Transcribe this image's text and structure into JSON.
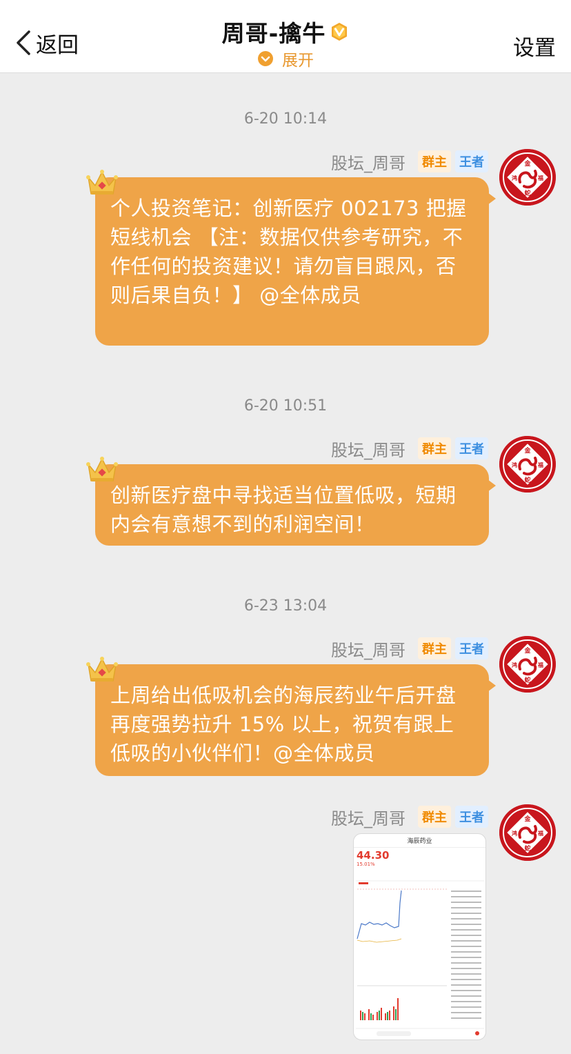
{
  "header": {
    "back_label": "返回",
    "title": "周哥-擒牛",
    "expand_label": "展开",
    "settings_label": "设置"
  },
  "messages": [
    {
      "time": "6-20 10:14",
      "sender": "股坛_周哥",
      "role_tag": "群主",
      "level_tag": "王者",
      "text": "个人投资笔记：创新医疗 002173 把握短线机会 【注：数据仅供参考研究，不作任何的投资建议！请勿盲目跟风，否则后果自负！】 @全体成员"
    },
    {
      "time": "6-20 10:51",
      "sender": "股坛_周哥",
      "role_tag": "群主",
      "level_tag": "王者",
      "text": "创新医疗盘中寻找适当位置低吸，短期内会有意想不到的利润空间！"
    },
    {
      "time": "6-23 13:04",
      "sender": "股坛_周哥",
      "role_tag": "群主",
      "level_tag": "王者",
      "text": "上周给出低吸机会的海辰药业午后开盘再度强势拉升 15% 以上，祝贺有跟上低吸的小伙伴们！@全体成员"
    },
    {
      "sender": "股坛_周哥",
      "role_tag": "群主",
      "level_tag": "王者",
      "image": {
        "title": "海辰药业",
        "price": "44.30",
        "change": "15.01%"
      }
    }
  ],
  "avatar_text": [
    "金",
    "鸿",
    "福",
    "蛇"
  ],
  "colors": {
    "bubble": "#efa448",
    "accent": "#e8982f",
    "avatar": "#c8161d"
  }
}
